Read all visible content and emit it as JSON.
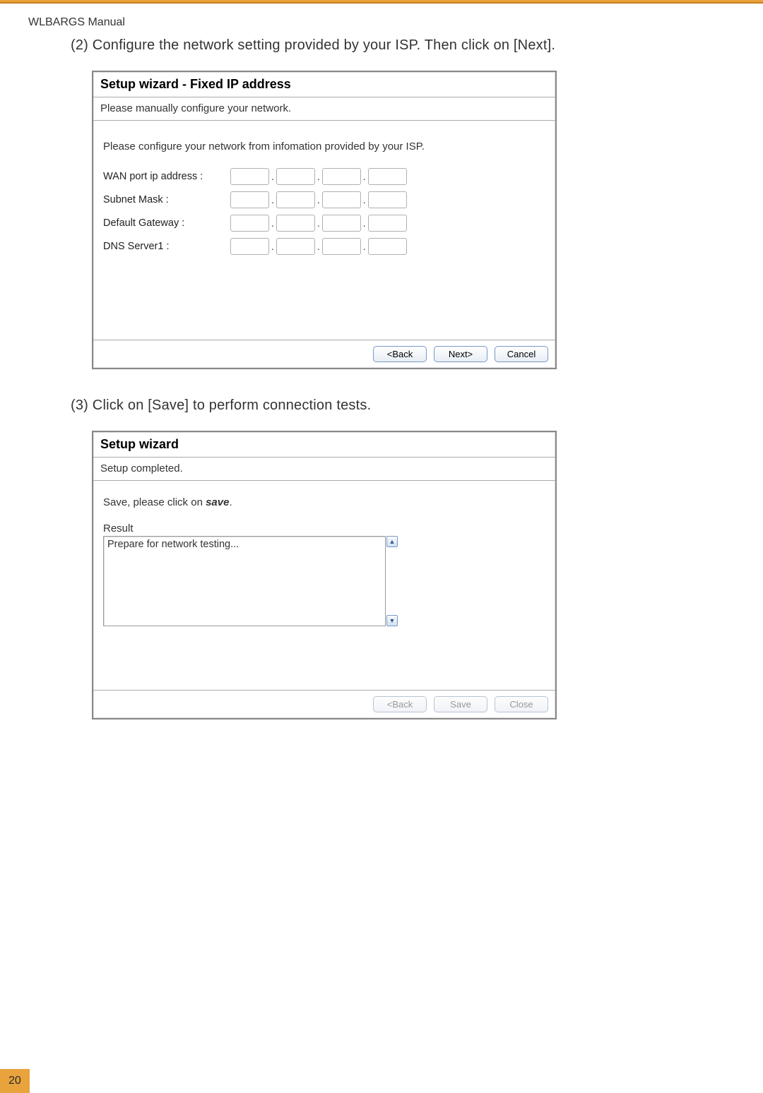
{
  "header": {
    "manual_title": "WLBARGS Manual"
  },
  "step2": {
    "text": "(2) Configure the network setting provided by your ISP. Then click on [Next]."
  },
  "wizard1": {
    "title": "Setup wizard - Fixed IP address",
    "sub": "Please manually configure your network.",
    "prompt": "Please configure your network from infomation provided by your ISP.",
    "fields": {
      "wan": "WAN port ip address :",
      "subnet": "Subnet Mask :",
      "gateway": "Default Gateway :",
      "dns1": "DNS Server1 :"
    },
    "buttons": {
      "back": "<Back",
      "next": "Next>",
      "cancel": "Cancel"
    }
  },
  "step3": {
    "text": "(3) Click on [Save] to perform connection tests."
  },
  "wizard2": {
    "title": "Setup wizard",
    "sub": "Setup completed.",
    "save_prefix": "Save, please click on ",
    "save_bold": "save",
    "save_suffix": ".",
    "result_label": "Result",
    "result_text": "Prepare for network testing...",
    "buttons": {
      "back": "<Back",
      "save": "Save",
      "close": "Close"
    }
  },
  "footer": {
    "page_number": "20"
  }
}
